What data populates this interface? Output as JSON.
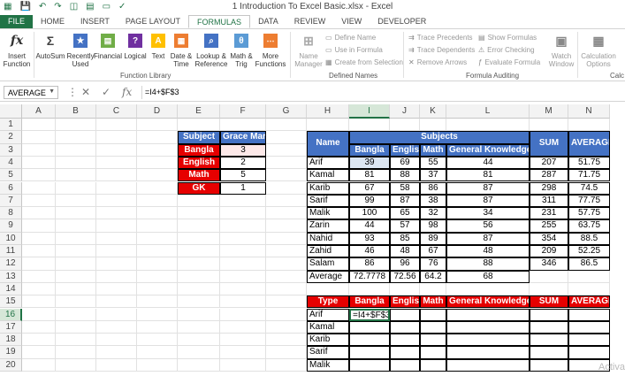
{
  "title": "1 Introduction To Excel Basic.xlsx - Excel",
  "tabs": [
    "FILE",
    "HOME",
    "INSERT",
    "PAGE LAYOUT",
    "FORMULAS",
    "DATA",
    "REVIEW",
    "VIEW",
    "DEVELOPER"
  ],
  "ribbon": {
    "insert_function": "Insert\nFunction",
    "autosum": "AutoSum",
    "recently_used": "Recently\nUsed",
    "financial": "Financial",
    "logical": "Logical",
    "text": "Text",
    "date_time": "Date &\nTime",
    "lookup_reference": "Lookup &\nReference",
    "math_trig": "Math &\nTrig",
    "more_functions": "More\nFunctions",
    "function_library": "Function Library",
    "name_manager": "Name\nManager",
    "define_name": "Define Name",
    "use_in_formula": "Use in Formula",
    "create_from_selection": "Create from Selection",
    "defined_names": "Defined Names",
    "trace_precedents": "Trace Precedents",
    "trace_dependents": "Trace Dependents",
    "remove_arrows": "Remove Arrows",
    "show_formulas": "Show Formulas",
    "error_checking": "Error Checking",
    "evaluate_formula": "Evaluate Formula",
    "watch_window": "Watch\nWindow",
    "formula_auditing": "Formula Auditing",
    "calculation_options": "Calculation\nOptions",
    "calc_group": "Calc"
  },
  "namebox": "AVERAGE",
  "formula": "=I4+$F$3",
  "columns": [
    "A",
    "B",
    "C",
    "D",
    "E",
    "F",
    "G",
    "H",
    "I",
    "J",
    "K",
    "L",
    "M",
    "N"
  ],
  "rows": [
    "1",
    "2",
    "3",
    "4",
    "5",
    "6",
    "7",
    "8",
    "9",
    "10",
    "11",
    "12",
    "13",
    "14",
    "15",
    "16",
    "17",
    "18",
    "19",
    "20"
  ],
  "grace_table": {
    "headers": [
      "Subject",
      "Grace Mark"
    ],
    "rows": [
      [
        "Bangla",
        "3"
      ],
      [
        "English",
        "2"
      ],
      [
        "Math",
        "5"
      ],
      [
        "GK",
        "1"
      ]
    ]
  },
  "main_table": {
    "name_header": "Name",
    "subjects_header": "Subjects",
    "sum_header": "SUM",
    "avg_header": "AVERAGE",
    "subject_cols": [
      "Bangla",
      "English",
      "Math",
      "General Knowledge"
    ],
    "rows": [
      [
        "Arif",
        "39",
        "69",
        "55",
        "44",
        "207",
        "51.75"
      ],
      [
        "Kamal",
        "81",
        "88",
        "37",
        "81",
        "287",
        "71.75"
      ],
      [
        "Karib",
        "67",
        "58",
        "86",
        "87",
        "298",
        "74.5"
      ],
      [
        "Sarif",
        "99",
        "87",
        "38",
        "87",
        "311",
        "77.75"
      ],
      [
        "Malik",
        "100",
        "65",
        "32",
        "34",
        "231",
        "57.75"
      ],
      [
        "Zarin",
        "44",
        "57",
        "98",
        "56",
        "255",
        "63.75"
      ],
      [
        "Nahid",
        "93",
        "85",
        "89",
        "87",
        "354",
        "88.5"
      ],
      [
        "Zahid",
        "46",
        "48",
        "67",
        "48",
        "209",
        "52.25"
      ],
      [
        "Salam",
        "86",
        "96",
        "76",
        "88",
        "346",
        "86.5"
      ]
    ],
    "avg_row": [
      "Average",
      "72.7778",
      "72.56",
      "64.2",
      "68"
    ]
  },
  "grace_result_table": {
    "headers": [
      "Type",
      "Bangla",
      "English",
      "Math",
      "General Knowledge",
      "SUM",
      "AVERAGE"
    ],
    "names": [
      "Arif",
      "Kamal",
      "Karib",
      "Sarif",
      "Malik"
    ],
    "editing_value": "=I4+$F$3"
  },
  "watermark": "Activa"
}
